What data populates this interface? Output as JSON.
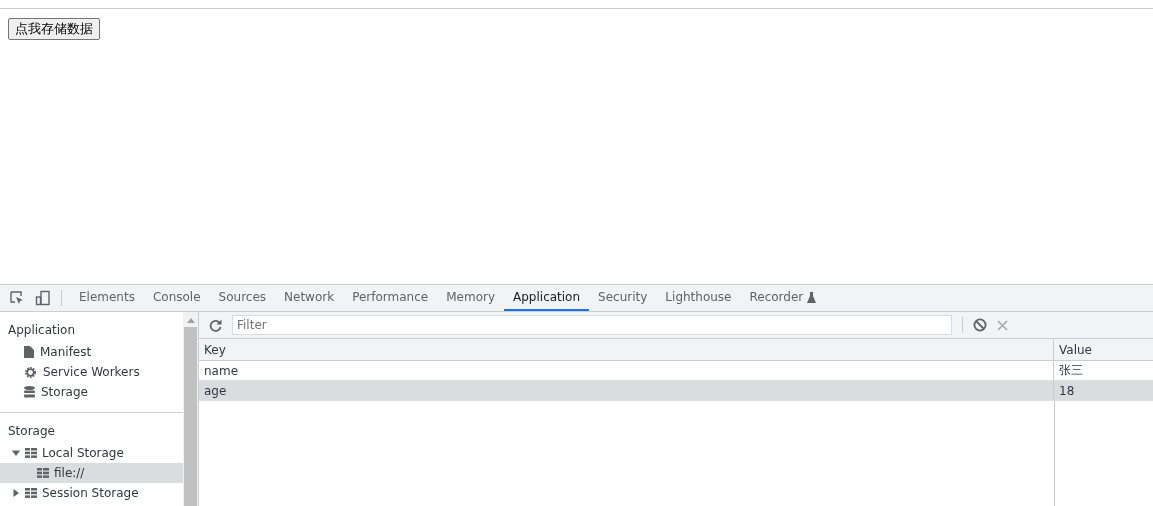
{
  "page_button": "点我存储数据",
  "tabs": [
    {
      "label": "Elements",
      "selected": false
    },
    {
      "label": "Console",
      "selected": false
    },
    {
      "label": "Sources",
      "selected": false
    },
    {
      "label": "Network",
      "selected": false
    },
    {
      "label": "Performance",
      "selected": false
    },
    {
      "label": "Memory",
      "selected": false
    },
    {
      "label": "Application",
      "selected": true
    },
    {
      "label": "Security",
      "selected": false
    },
    {
      "label": "Lighthouse",
      "selected": false
    },
    {
      "label": "Recorder",
      "selected": false,
      "experimental": true
    }
  ],
  "sidebar": {
    "sections": [
      {
        "title": "Application",
        "items": [
          {
            "label": "Manifest",
            "kind": "file"
          },
          {
            "label": "Service Workers",
            "kind": "gear"
          },
          {
            "label": "Storage",
            "kind": "database"
          }
        ]
      },
      {
        "title": "Storage",
        "tree": [
          {
            "label": "Local Storage",
            "expanded": true,
            "selected": false,
            "children": [
              {
                "label": "file://",
                "selected": true
              }
            ]
          },
          {
            "label": "Session Storage",
            "expanded": false,
            "selected": false
          }
        ]
      }
    ]
  },
  "filter": {
    "placeholder": "Filter"
  },
  "table": {
    "columns": [
      "Key",
      "Value"
    ],
    "rows": [
      {
        "cells": [
          "name",
          "张三"
        ],
        "selected": false
      },
      {
        "cells": [
          "age",
          "18"
        ],
        "selected": true
      }
    ]
  }
}
